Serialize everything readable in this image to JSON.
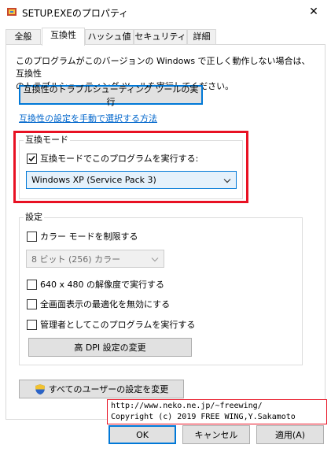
{
  "window": {
    "title": "SETUP.EXEのプロパティ",
    "close_symbol": "✕"
  },
  "tabs": [
    {
      "label": "全般",
      "active": false
    },
    {
      "label": "互換性",
      "active": true
    },
    {
      "label": "ハッシュ値",
      "active": false
    },
    {
      "label": "セキュリティ",
      "active": false
    },
    {
      "label": "詳細",
      "active": false
    }
  ],
  "compat": {
    "desc_line1": "このプログラムがこのバージョンの Windows で正しく動作しない場合は、互換性",
    "desc_line2": "のトラブルシューティング ツールを実行してください。",
    "troubleshoot_button": "互換性のトラブルシューティング ツールの実行",
    "manual_link": "互換性の設定を手動で選択する方法"
  },
  "compat_mode": {
    "group_label": "互換モード",
    "checkbox_label": "互換モードでこのプログラムを実行する:",
    "checked": true,
    "selected_os": "Windows XP (Service Pack 3)"
  },
  "settings": {
    "group_label": "設定",
    "reduced_color_label": "カラー モードを制限する",
    "color_select_value": "8 ビット (256) カラー",
    "resolution_label": "640 x 480 の解像度で実行する",
    "fullscreen_label": "全画面表示の最適化を無効にする",
    "admin_label": "管理者としてこのプログラムを実行する",
    "dpi_button": "高 DPI 設定の変更"
  },
  "all_users_button": "すべてのユーザーの設定を変更",
  "overlay": {
    "line1": "http://www.neko.ne.jp/~freewing/",
    "line2": "Copyright (c) 2019 FREE WING,Y.Sakamoto"
  },
  "footer": {
    "ok": "OK",
    "cancel": "キャンセル",
    "apply": "適用(A)"
  },
  "colors": {
    "accent": "#0078d7",
    "highlight_red": "#e81123",
    "link": "#0066cc"
  },
  "icons": [
    "app-icon",
    "close-icon",
    "check-icon",
    "chevron-down-icon",
    "uac-shield-icon"
  ]
}
